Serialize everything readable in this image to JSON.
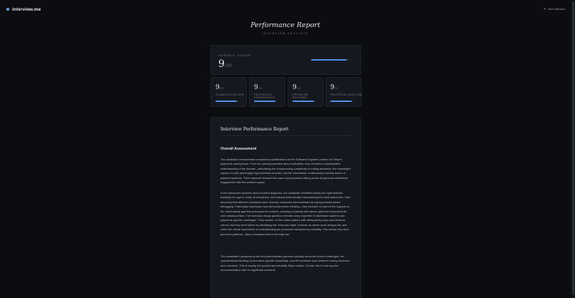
{
  "header": {
    "brand": "interview.me",
    "new_interview": "New Interview",
    "accent": "#6aa6ff"
  },
  "report": {
    "title": "Performance Report",
    "subtitle": "INTERVIEW ANALYSIS"
  },
  "overall": {
    "label": "OVERALL SCORE",
    "score": "9",
    "denominator": "/10",
    "fraction": 0.9
  },
  "categories": [
    {
      "score": "9",
      "denominator": "/10",
      "label_lines": [
        "COMMUNICATION"
      ],
      "fraction": 0.9
    },
    {
      "score": "9",
      "denominator": "/10",
      "label_lines": [
        "TECHNICAL",
        "KNOWLEDGE"
      ],
      "fraction": 0.9
    },
    {
      "score": "9",
      "denominator": "/10",
      "label_lines": [
        "PROBLEM",
        "SOLVING"
      ],
      "fraction": 0.9
    },
    {
      "score": "9",
      "denominator": "/10",
      "label_lines": [
        "PROFESSIONALISM"
      ],
      "fraction": 0.9
    }
  ],
  "document": {
    "title": "Interview Performance Report",
    "section_heading": "Overall Assessment",
    "paragraphs": [
      "The candidate demonstrated exceptional qualifications for the Software Engineer position on Stripe's payments routing team. From the opening question about motivation, they revealed a sophisticated understanding of the domain—articulating the compounding complexity of routing decisions, the meaningful impact of small percentage improvements at scale, and the adversarial, continuously evolving nature of payment systems. Their response showed this wasn't just prepared talking points but genuine intellectual engagement with the problem space.",
      "In the behavioral question about incident diagnosis, the candidate exhibited exactly the right instincts: resisting the urge to \"poke at everything\" and instead methodically characterizing the blast radius first. Their discovery that affected merchants were recently onboarded demonstrated strong hypothesis-driven debugging. Particularly impressive was their postmortem thinking—they focused not just on the bug but on the observability gap that prolonged the incident, showing a maturity that values systemic improvements over individual fixes. The technical design question revealed deep expertise in distributed systems and payments-specific challenges. Their answer on the outbox pattern with idempotency keys was textbook correct, but they went further by identifying the \"unknown state\" problem as where most designs fail, and noted the critical importance of understanding per-processor idempotency reliability. This shows they don't just know patterns—they understand where the traps are.",
      "The candidate's questions at the end demonstrated genuine curiosity about the team's challenges, the organizational handling of processor-specific knowledge, and the feedback loop between routing decisions and outcomes. This is exactly the product-led mentality Stripe values. Overall, this is a strong hire recommendation with no significant concerns."
    ]
  }
}
